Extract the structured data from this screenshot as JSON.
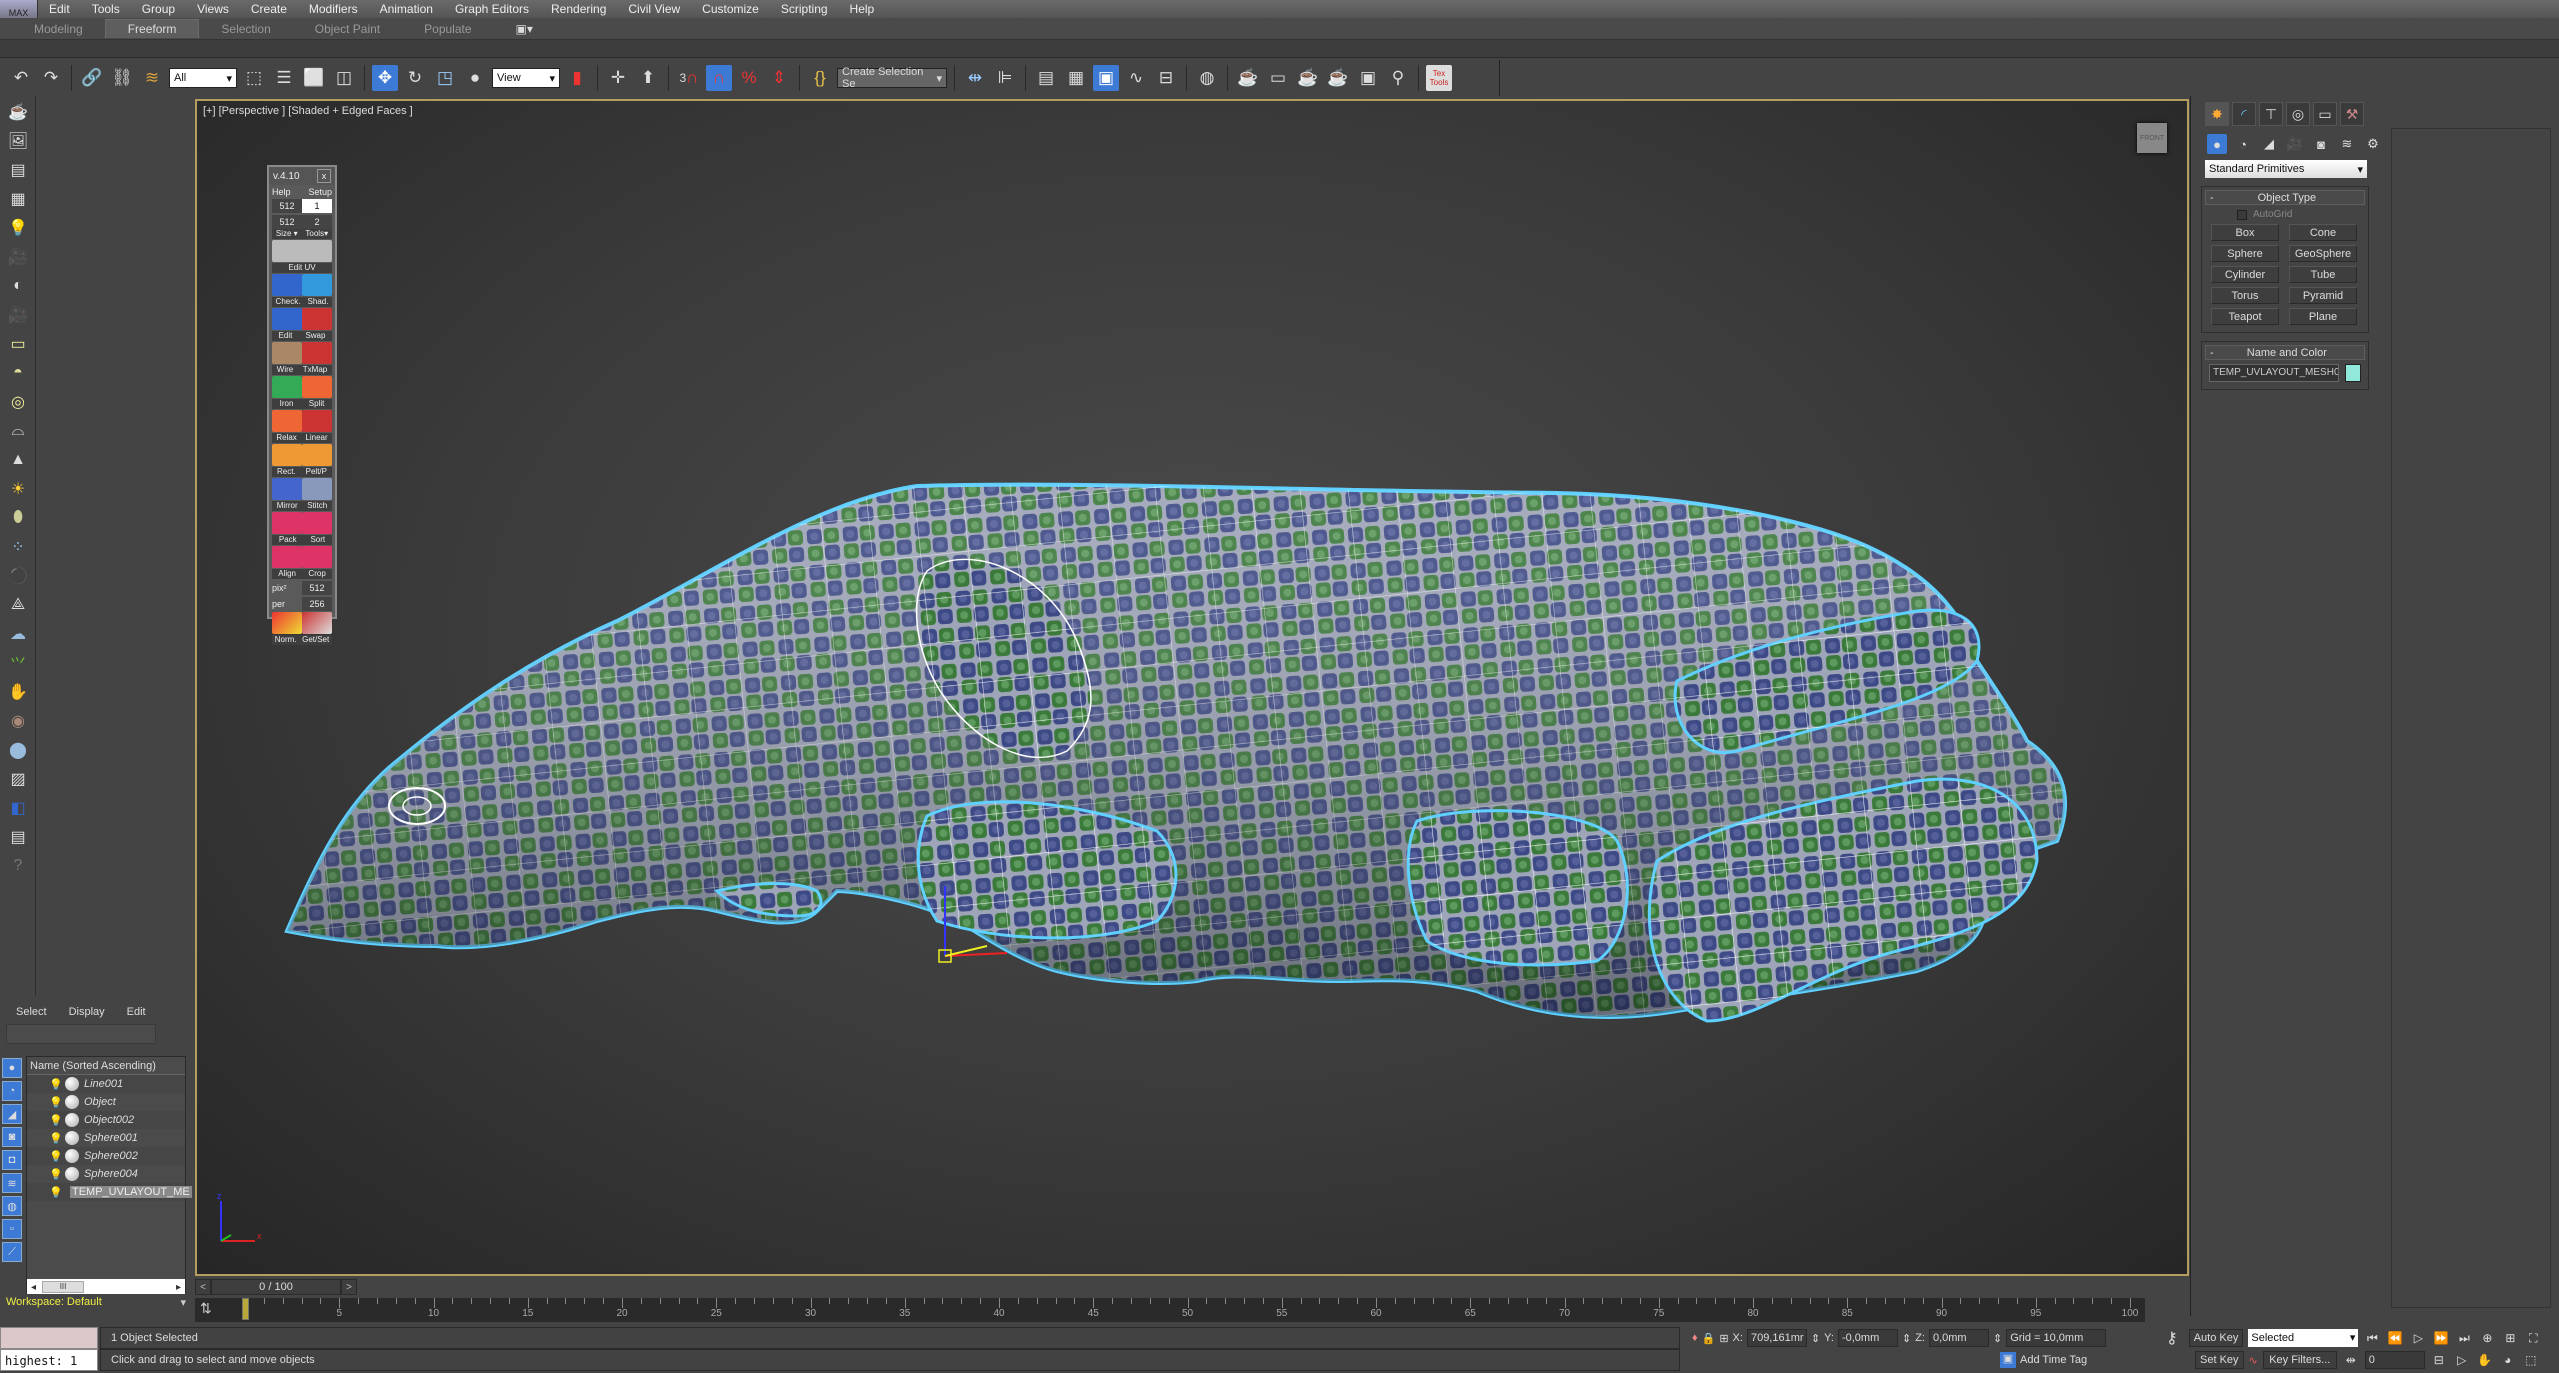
{
  "app": {
    "logo_label": "MAX"
  },
  "menu": [
    "Edit",
    "Tools",
    "Group",
    "Views",
    "Create",
    "Modifiers",
    "Animation",
    "Graph Editors",
    "Rendering",
    "Civil View",
    "Customize",
    "Scripting",
    "Help"
  ],
  "ribbon": {
    "tabs": [
      "Modeling",
      "Freeform",
      "Selection",
      "Object Paint",
      "Populate"
    ],
    "active": "Freeform"
  },
  "toolbar": {
    "selection_filter": "All",
    "reference_coord": "View",
    "named_selection": "Create Selection Se",
    "snap_toggle_label": "3",
    "texttools_label": "Tex Tools",
    "icons": [
      "undo-icon",
      "redo-icon",
      "link-icon",
      "unlink-icon",
      "bind-space-warp-icon",
      "select-object-icon",
      "select-by-name-icon",
      "rect-selection-icon",
      "window-crossing-icon",
      "select-move-icon",
      "select-rotate-icon",
      "select-scale-icon",
      "select-place-icon",
      "use-pivot-icon",
      "select-manipulate-icon",
      "keyboard-shortcut-icon",
      "snaps-toggle-icon",
      "angle-snap-icon",
      "percent-snap-icon",
      "spinner-snap-icon",
      "edit-named-selection-icon",
      "mirror-icon",
      "align-icon",
      "layer-explorer-icon",
      "toggle-ribbon-icon",
      "curve-editor-icon",
      "schematic-view-icon",
      "material-editor-icon",
      "render-setup-icon",
      "rendered-frame-icon",
      "render-production-icon",
      "render-iterative-icon",
      "render-activeshade-icon",
      "render-in-cloud-icon"
    ]
  },
  "left_toolbar": {
    "icons": [
      "teapot-icon",
      "render-frame-icon",
      "panel-icon",
      "grid-panel-icon",
      "light-lister-icon",
      "camera-icon",
      "camera-target-icon",
      "camera-physical-icon",
      "area-light-icon",
      "skylight-icon",
      "omni-light-icon",
      "sun-positioner-icon",
      "spotlight-icon",
      "sunlight-icon",
      "dome-light-icon",
      "particle-icon",
      "dynamics-icon",
      "grid-helper-icon",
      "cloud-icon",
      "grass-icon",
      "hair-fur-icon",
      "ox-hair-icon",
      "sphere-material-icon",
      "material-map-icon",
      "viewport-material-icon",
      "script-icon",
      "help-icon"
    ]
  },
  "viewport": {
    "label": "[+] [Perspective ] [Shaded + Edged Faces ]",
    "viewcube_label": "FRONT",
    "axis": {
      "x": "x",
      "z": "z"
    }
  },
  "uvlayout_panel": {
    "version": "v.4.10",
    "close": "x",
    "help": "Help",
    "setup": "Setup",
    "size1": "512",
    "size2": "512",
    "tools1": "1",
    "tools2": "2",
    "size_label": "Size ▾",
    "tools_label": "Tools▾",
    "edit_uv": "Edit  UV",
    "buttons": [
      [
        "Check.",
        "Shad."
      ],
      [
        "Edit",
        "Swap"
      ],
      [
        "Wire",
        "TxMap"
      ],
      [
        "Iron",
        "Split"
      ],
      [
        "Relax",
        "Linear"
      ],
      [
        "Rect.",
        "Pelt/P"
      ],
      [
        "Mirror",
        "Stitch"
      ],
      [
        "Pack",
        "Sort"
      ],
      [
        "Align",
        "Crop"
      ]
    ],
    "pix_label": "pix²",
    "pix_value": "512",
    "per_label": "per",
    "per_value": "256",
    "last": [
      "Norm.",
      "Get/Set"
    ]
  },
  "command_panel": {
    "tabs": [
      "create-tab",
      "modify-tab",
      "hierarchy-tab",
      "motion-tab",
      "display-tab",
      "utilities-tab"
    ],
    "subtabs": [
      "geometry",
      "shapes",
      "lights",
      "cameras",
      "helpers",
      "space-warps",
      "systems"
    ],
    "category": "Standard Primitives",
    "object_type": {
      "title": "Object Type",
      "autogrid": "AutoGrid",
      "buttons": [
        "Box",
        "Cone",
        "Sphere",
        "GeoSphere",
        "Cylinder",
        "Tube",
        "Torus",
        "Pyramid",
        "Teapot",
        "Plane"
      ]
    },
    "name_and_color": {
      "title": "Name and Color",
      "name": "TEMP_UVLAYOUT_MESH0(",
      "color": "#91e9d9"
    }
  },
  "scene_explorer": {
    "menu": [
      "Select",
      "Display",
      "Edit"
    ],
    "column_header": "Name (Sorted Ascending)",
    "items": [
      {
        "name": "Line001",
        "selected": false
      },
      {
        "name": "Object",
        "selected": false
      },
      {
        "name": "Object002",
        "selected": false
      },
      {
        "name": "Sphere001",
        "selected": false
      },
      {
        "name": "Sphere002",
        "selected": false
      },
      {
        "name": "Sphere004",
        "selected": false
      },
      {
        "name": "TEMP_UVLAYOUT_ME",
        "selected": true
      }
    ],
    "scroll_thumb": "III",
    "workspace": "Workspace: Default"
  },
  "maxscript": {
    "output": "highest: 1"
  },
  "time_slider": {
    "value": "0 / 100",
    "current": 0,
    "start": 0,
    "end": 100
  },
  "status": {
    "selection": "1 Object Selected",
    "prompt": "Click and drag to select and move objects",
    "x_label": "X:",
    "x": "709,161mr",
    "y_label": "Y:",
    "y": "-0,0mm",
    "z_label": "Z:",
    "z": "0,0mm",
    "grid": "Grid = 10,0mm",
    "add_time_tag": "Add Time Tag"
  },
  "animation": {
    "auto_key": "Auto Key",
    "set_key": "Set Key",
    "key_mode": "Selected",
    "key_filters": "Key Filters...",
    "frame": "0"
  },
  "colors": {
    "accent": "#3d7ad6",
    "viewport_border": "#b49d5d",
    "wire": "#ffffff",
    "outline": "#5fd0ff",
    "checker_a": "#3e4a86",
    "checker_b": "#3c7a3c"
  }
}
